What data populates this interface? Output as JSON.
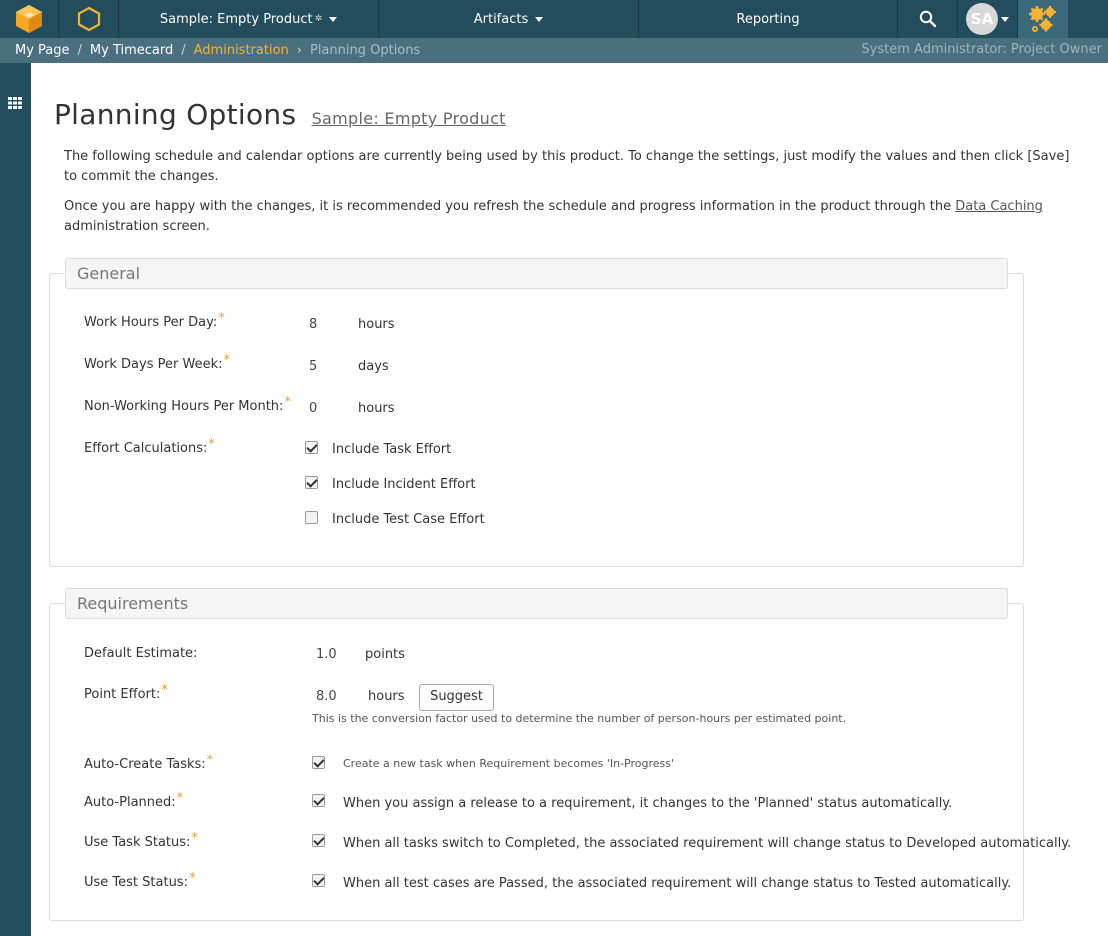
{
  "nav": {
    "product": "Sample: Empty Product",
    "artifacts": "Artifacts",
    "reporting": "Reporting",
    "user_initials": "SA"
  },
  "breadcrumb": {
    "my_page": "My Page",
    "sep": "/",
    "my_timecard": "My Timecard",
    "administration": "Administration",
    "current": "Planning Options",
    "role": "System Administrator: Project Owner"
  },
  "page": {
    "title": "Planning Options",
    "subtitle": "Sample: Empty Product",
    "intro1": "The following schedule and calendar options are currently being used by this product. To change the settings, just modify the values and then click [Save] to commit the changes.",
    "intro2_pre": "Once you are happy with the changes, it is recommended you refresh the schedule and progress information in the product through the ",
    "intro2_link": "Data Caching",
    "intro2_post": " administration screen."
  },
  "general": {
    "legend": "General",
    "work_hours_label": "Work Hours Per Day:",
    "work_hours_value": "8",
    "work_hours_unit": "hours",
    "work_days_label": "Work Days Per Week:",
    "work_days_value": "5",
    "work_days_unit": "days",
    "non_working_label": "Non-Working Hours Per Month:",
    "non_working_value": "0",
    "non_working_unit": "hours",
    "effort_label": "Effort Calculations:",
    "effort_options": [
      {
        "label": "Include Task Effort",
        "checked": true
      },
      {
        "label": "Include Incident Effort",
        "checked": true
      },
      {
        "label": "Include Test Case Effort",
        "checked": false
      }
    ]
  },
  "requirements": {
    "legend": "Requirements",
    "default_estimate_label": "Default Estimate:",
    "default_estimate_value": "1.0",
    "default_estimate_unit": "points",
    "point_effort_label": "Point Effort:",
    "point_effort_value": "8.0",
    "point_effort_unit": "hours",
    "suggest_button": "Suggest",
    "point_effort_note": "This is the conversion factor used to determine the number of person-hours per estimated point.",
    "auto_create_label": "Auto-Create Tasks:",
    "auto_create_desc": "Create a new task when Requirement becomes 'In-Progress'",
    "auto_planned_label": "Auto-Planned:",
    "auto_planned_desc": "When you assign a release to a requirement, it changes to the 'Planned' status automatically.",
    "task_status_label": "Use Task Status:",
    "task_status_desc": "When all tasks switch to Completed, the associated requirement will change status to Developed automatically.",
    "test_status_label": "Use Test Status:",
    "test_status_desc": "When all test cases are Passed, the associated requirement will change status to Tested automatically."
  },
  "colors": {
    "nav_bg": "#234d5c",
    "crumb_bg": "#4a7080",
    "accent": "#f5b335"
  }
}
